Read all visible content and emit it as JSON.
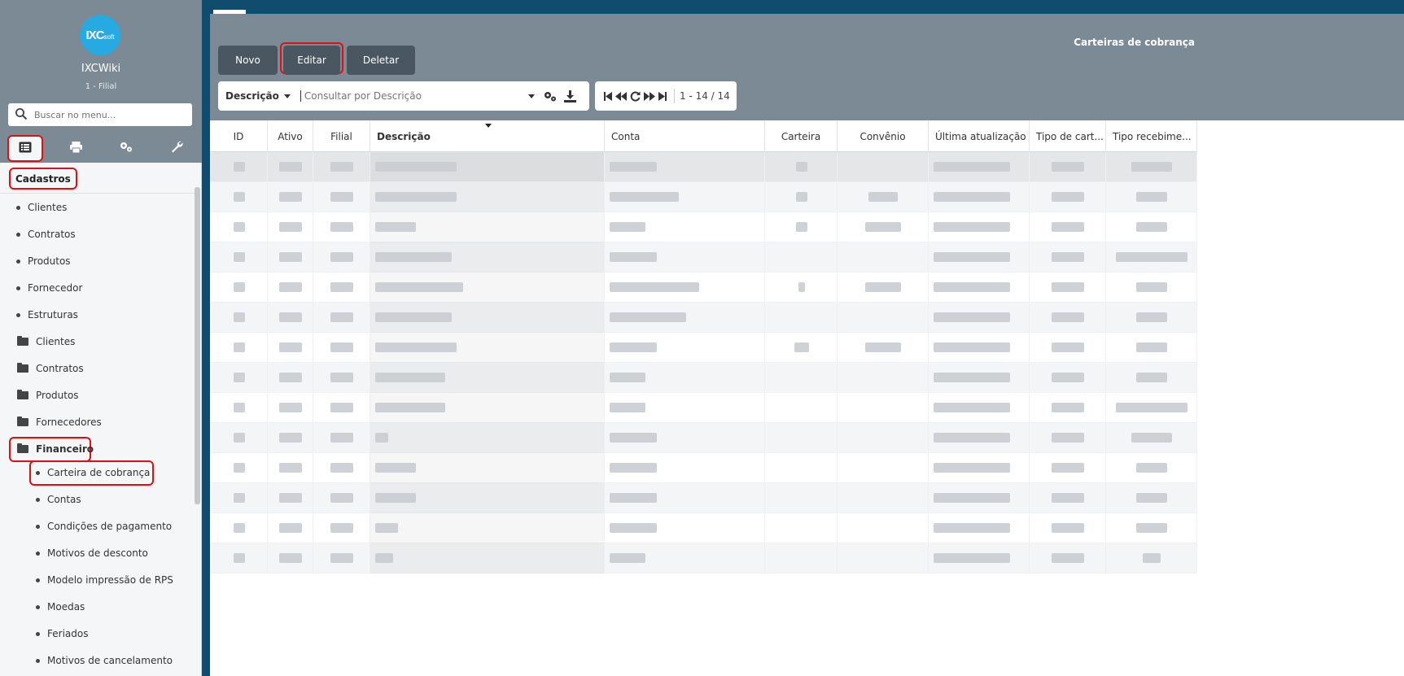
{
  "sidebar": {
    "logo_text": "IXC",
    "logo_small": "soft",
    "brand": "IXCWiki",
    "branch": "1 - Filial",
    "search_placeholder": "Buscar no menu...",
    "section_label": "Cadastros",
    "items": [
      {
        "label": "Clientes"
      },
      {
        "label": "Contratos"
      },
      {
        "label": "Produtos"
      },
      {
        "label": "Fornecedor"
      },
      {
        "label": "Estruturas"
      }
    ],
    "folders": [
      {
        "label": "Clientes"
      },
      {
        "label": "Contratos"
      },
      {
        "label": "Produtos"
      },
      {
        "label": "Fornecedores"
      },
      {
        "label": "Financeiro"
      }
    ],
    "financeiro_items": [
      {
        "label": "Carteira de cobrança"
      },
      {
        "label": "Contas"
      },
      {
        "label": "Condições de pagamento"
      },
      {
        "label": "Motivos de desconto"
      },
      {
        "label": "Modelo impressão de RPS"
      },
      {
        "label": "Moedas"
      },
      {
        "label": "Feriados"
      },
      {
        "label": "Motivos de cancelamento"
      }
    ]
  },
  "main": {
    "title": "Carteiras de cobrança",
    "toolbar": {
      "novo": "Novo",
      "editar": "Editar",
      "deletar": "Deletar"
    },
    "filter": {
      "field": "Descrição",
      "placeholder": "Consultar por Descrição"
    },
    "pager": {
      "range": "1 - 14 / 14"
    },
    "columns": [
      "ID",
      "Ativo",
      "Filial",
      "Descrição",
      "Conta",
      "Carteira",
      "Convênio",
      "Última atualização",
      "Tipo de cart...",
      "Tipo recebime..."
    ]
  },
  "colors": {
    "accent_header": "#7b8a94",
    "top_strip": "#0f4c6e",
    "button": "#4a5660",
    "highlight": "#e01010"
  }
}
